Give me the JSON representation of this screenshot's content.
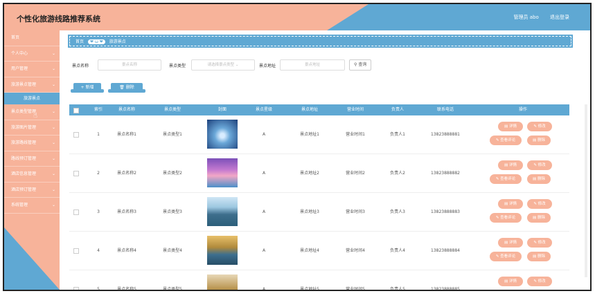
{
  "header": {
    "title": "个性化旅游线路推荐系统",
    "admin": "管理员 abo",
    "logout": "退出登录"
  },
  "sidebar": {
    "items": [
      {
        "label": "首页",
        "chev": false
      },
      {
        "label": "个人中心",
        "chev": true
      },
      {
        "label": "用户管理",
        "chev": true
      },
      {
        "label": "旅游景点管理",
        "chev": true
      },
      {
        "label": "景点类型管理",
        "chev": true
      },
      {
        "label": "旅游图片管理",
        "chev": true
      },
      {
        "label": "旅游路线管理",
        "chev": true
      },
      {
        "label": "路线预订管理",
        "chev": true
      },
      {
        "label": "酒店信息管理",
        "chev": true
      },
      {
        "label": "酒店预订管理",
        "chev": true
      },
      {
        "label": "系统管理",
        "chev": true
      }
    ],
    "subitem": "旅游景点"
  },
  "breadcrumb": {
    "home": "首页",
    "hearts": "❤ ω ❤",
    "current": "旅游景点"
  },
  "search": {
    "name_label": "景点名称",
    "name_placeholder": "景点名称",
    "type_label": "景点类型",
    "type_placeholder": "请选择景点类型",
    "addr_label": "景点地址",
    "addr_placeholder": "景点地址",
    "query_label": "查询"
  },
  "actions": {
    "add": "+ 新增",
    "delete": "删除"
  },
  "table": {
    "columns": [
      "索引",
      "景点名称",
      "景点类型",
      "封面",
      "景点星级",
      "景点地址",
      "营业时间",
      "负责人",
      "联系电话",
      "操作"
    ],
    "rows": [
      {
        "index": "1",
        "name": "景点名称1",
        "type": "景点类型1",
        "star": "A",
        "addr": "景点地址1",
        "hours": "营业时间1",
        "manager": "负责人1",
        "phone": "13823888881"
      },
      {
        "index": "2",
        "name": "景点名称2",
        "type": "景点类型2",
        "star": "A",
        "addr": "景点地址2",
        "hours": "营业时间2",
        "manager": "负责人2",
        "phone": "13823888882"
      },
      {
        "index": "3",
        "name": "景点名称3",
        "type": "景点类型3",
        "star": "A",
        "addr": "景点地址3",
        "hours": "营业时间3",
        "manager": "负责人3",
        "phone": "13823888883"
      },
      {
        "index": "4",
        "name": "景点名称4",
        "type": "景点类型4",
        "star": "A",
        "addr": "景点地址4",
        "hours": "营业时间4",
        "manager": "负责人4",
        "phone": "13823888884"
      },
      {
        "index": "5",
        "name": "景点名称5",
        "type": "景点类型5",
        "star": "A",
        "addr": "景点地址5",
        "hours": "营业时间5",
        "manager": "负责人5",
        "phone": "13823888885"
      }
    ],
    "ops": {
      "detail": "详情",
      "edit": "修改",
      "comments": "查看评论",
      "delete": "删除"
    }
  },
  "colors": {
    "peach": "#f7b39a",
    "blue": "#5fa8d3"
  }
}
